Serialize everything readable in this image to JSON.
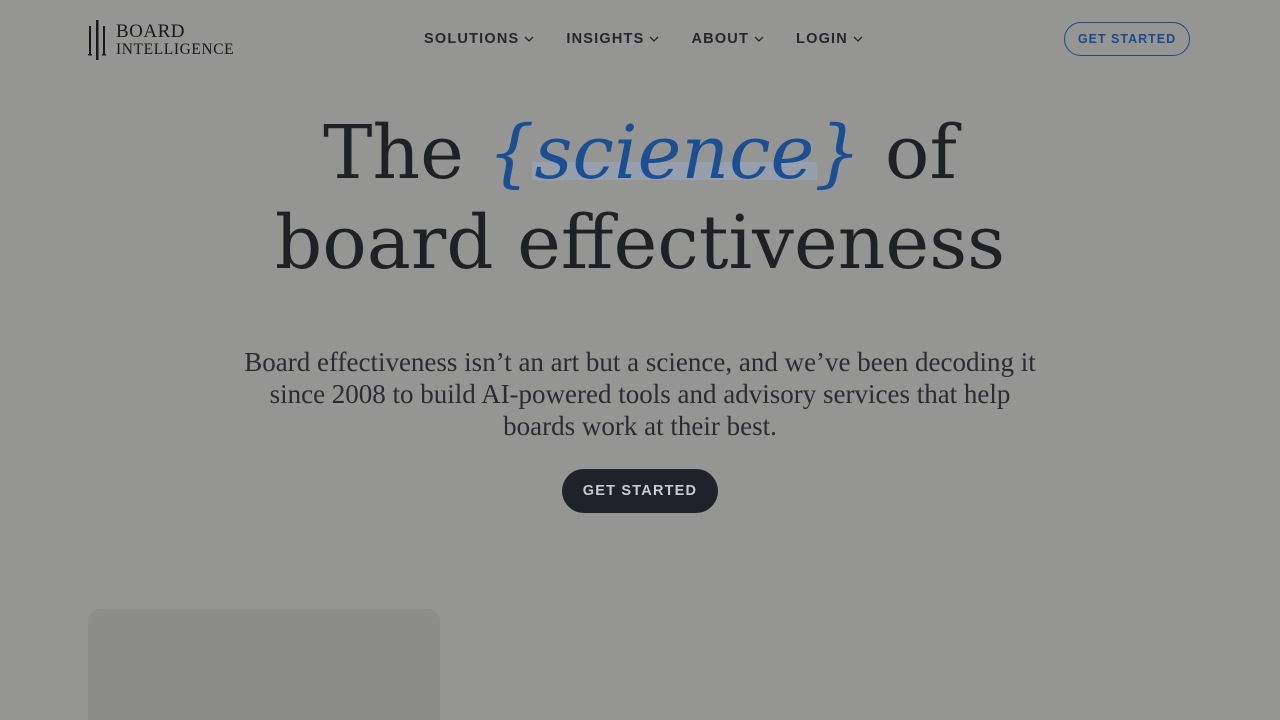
{
  "brand": {
    "line1": "BOARD",
    "line2": "INTELLIGENCE"
  },
  "nav": {
    "items": [
      {
        "label": "SOLUTIONS"
      },
      {
        "label": "INSIGHTS"
      },
      {
        "label": "ABOUT"
      },
      {
        "label": "LOGIN"
      }
    ]
  },
  "header": {
    "cta_label": "GET STARTED"
  },
  "hero": {
    "title_prefix": "The ",
    "title_highlight": "{science}",
    "title_suffix": " of",
    "title_line2": "board effectiveness",
    "subtitle": "Board effectiveness isn’t an art but a science, and we’ve been decoding it since 2008 to build AI-powered tools and advisory services that help boards work at their best.",
    "cta_label": "GET STARTED"
  },
  "colors": {
    "background": "#959594",
    "accent": "#1a4f94",
    "text": "#1f2125",
    "button_dark": "#1f2329"
  }
}
